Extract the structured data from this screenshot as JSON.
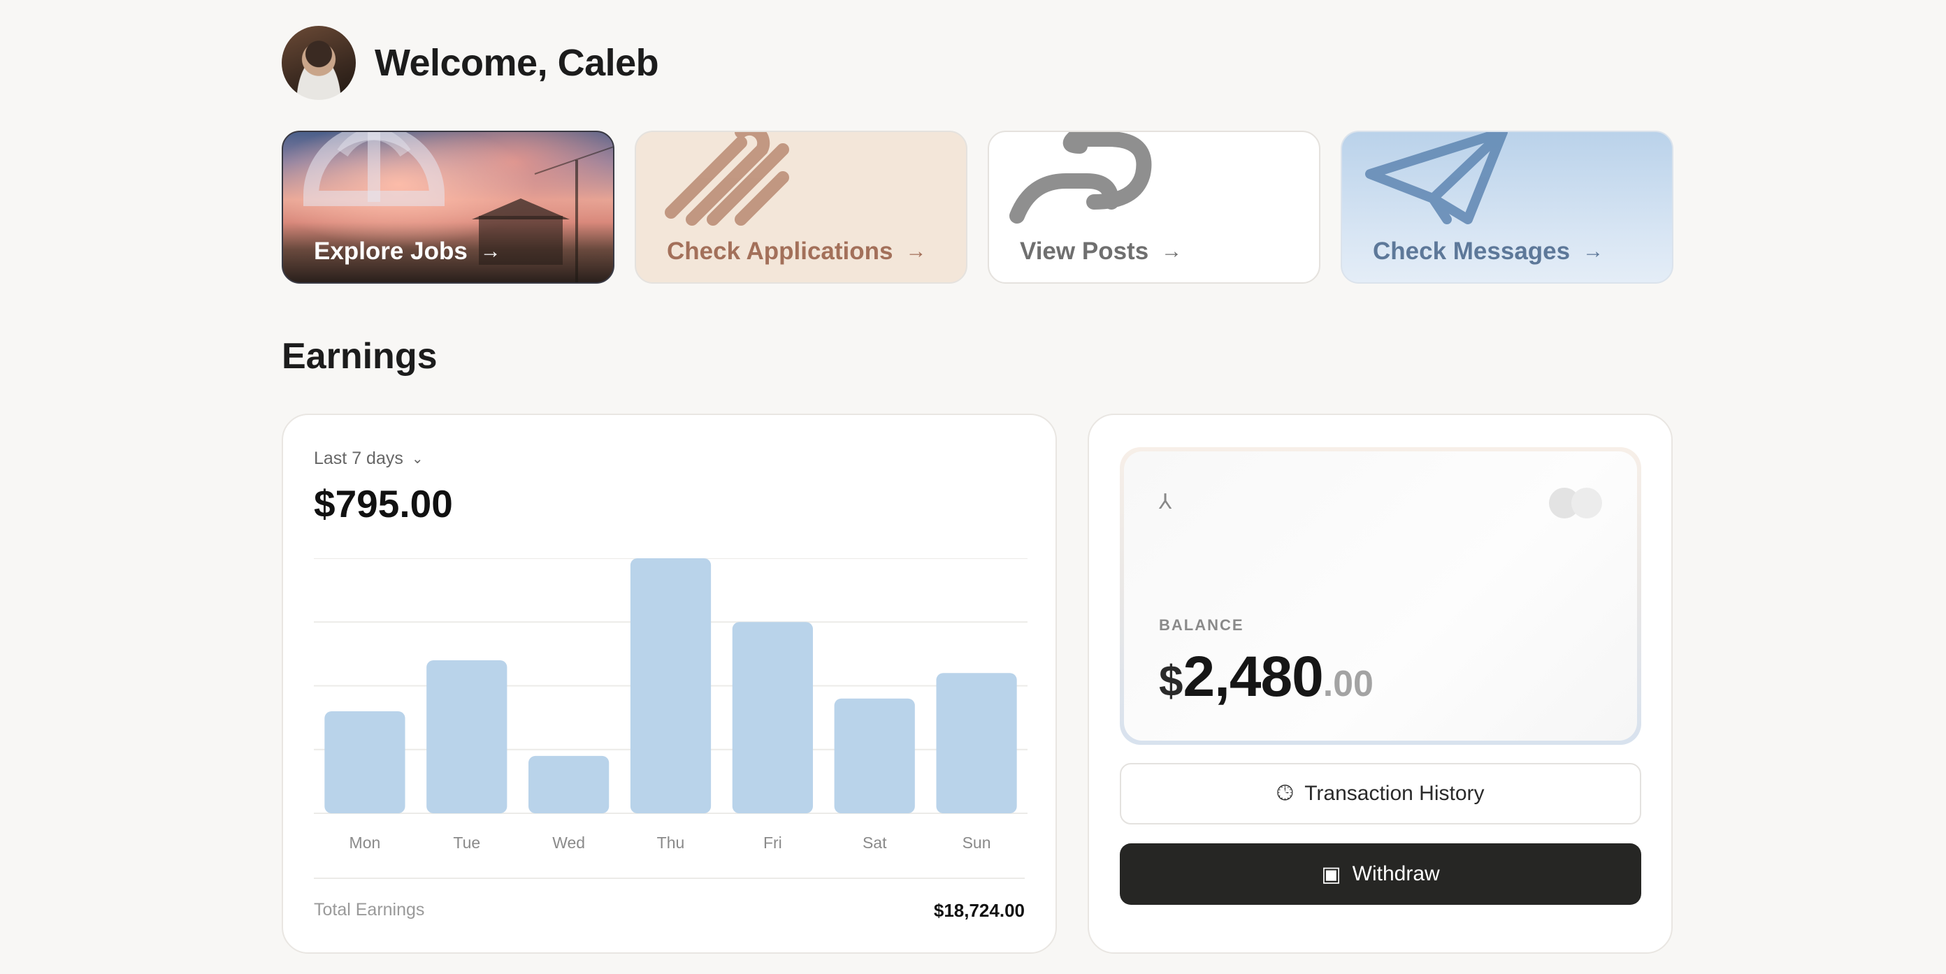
{
  "header": {
    "welcome": "Welcome, Caleb"
  },
  "cards": [
    {
      "label": "Explore Jobs",
      "arrow": "→",
      "icon": "dome-icon"
    },
    {
      "label": "Check Applications",
      "arrow": "→",
      "icon": "paperclip-icon"
    },
    {
      "label": "View Posts",
      "arrow": "→",
      "icon": "link-icon"
    },
    {
      "label": "Check Messages",
      "arrow": "→",
      "icon": "paper-plane-icon"
    }
  ],
  "earnings": {
    "title": "Earnings",
    "range": "Last 7 days",
    "amount": "$795.00",
    "total_label": "Total Earnings",
    "total_value": "$18,724.00"
  },
  "chart_data": {
    "type": "bar",
    "categories": [
      "Mon",
      "Tue",
      "Wed",
      "Thu",
      "Fri",
      "Sat",
      "Sun"
    ],
    "values": [
      80,
      120,
      45,
      200,
      150,
      90,
      110
    ],
    "ylim": [
      0,
      200
    ],
    "grid": true,
    "bar_color": "#b9d3ea"
  },
  "balance": {
    "label": "BALANCE",
    "currency": "$",
    "integer": "2,480",
    "decimal": ".00",
    "history_label": "Transaction History",
    "withdraw_label": "Withdraw"
  }
}
